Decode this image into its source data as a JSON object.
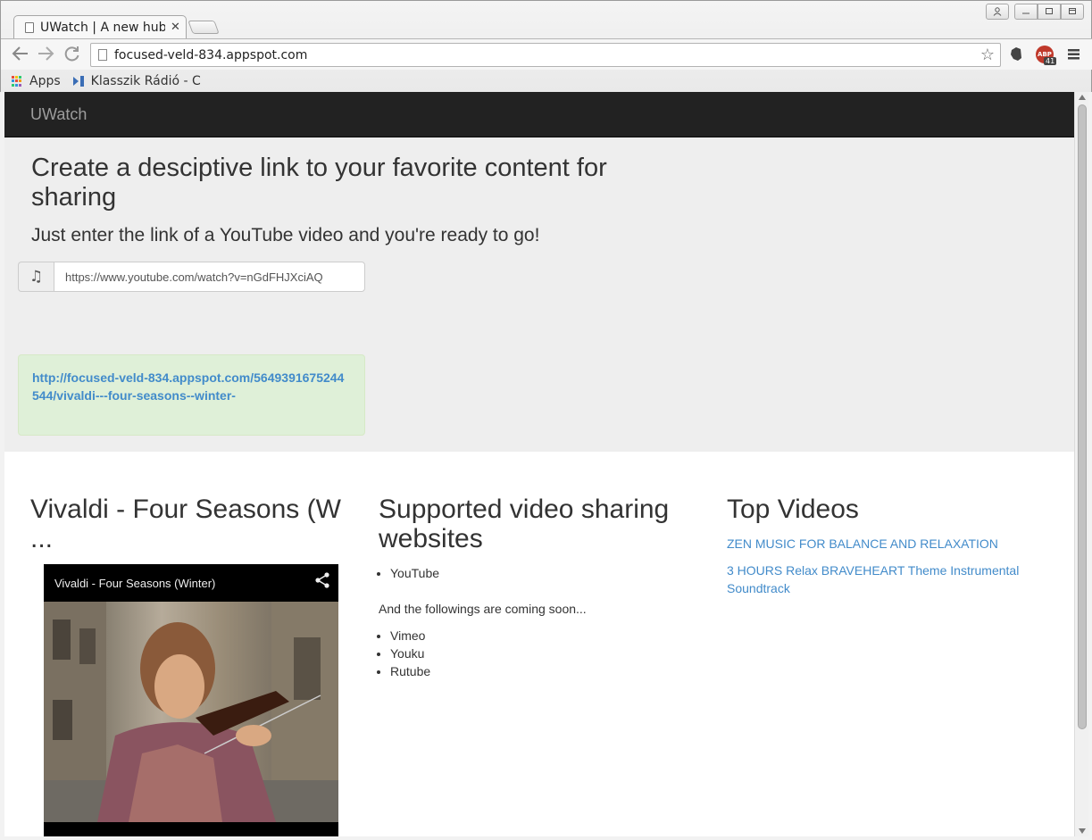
{
  "browser": {
    "tab_title": "UWatch | A new hub",
    "url": "focused-veld-834.appspot.com",
    "abp_label": "ABP",
    "abp_count": "41",
    "bookmarks": [
      {
        "label": "Apps"
      },
      {
        "label": "Klasszik Rádió - C"
      }
    ]
  },
  "navbar": {
    "brand": "UWatch"
  },
  "jumbotron": {
    "title": "Create a desciptive link to your favorite content for sharing",
    "lead": "Just enter the link of a YouTube video and you're ready to go!",
    "input_value": "https://www.youtube.com/watch?v=nGdFHJXciAQ",
    "generated_link": "http://focused-veld-834.appspot.com/5649391675244544/vivaldi---four-seasons--winter-"
  },
  "video_section": {
    "heading": "Vivaldi - Four Seasons (W ...",
    "player_title": "Vivaldi - Four Seasons (Winter)"
  },
  "supported": {
    "heading": "Supported video sharing websites",
    "current": [
      "YouTube"
    ],
    "coming_text": "And the followings are coming soon...",
    "coming": [
      "Vimeo",
      "Youku",
      "Rutube"
    ]
  },
  "top_videos": {
    "heading": "Top Videos",
    "items": [
      {
        "label": "ZEN MUSIC FOR BALANCE AND RELAXATION"
      },
      {
        "label": "3 HOURS Relax BRAVEHEART Theme Instrumental Soundtrack"
      }
    ]
  },
  "colors": {
    "navbar_bg": "#222222",
    "jumbotron_bg": "#eeeeee",
    "link": "#428bca",
    "alert_bg": "#dff0d8"
  }
}
